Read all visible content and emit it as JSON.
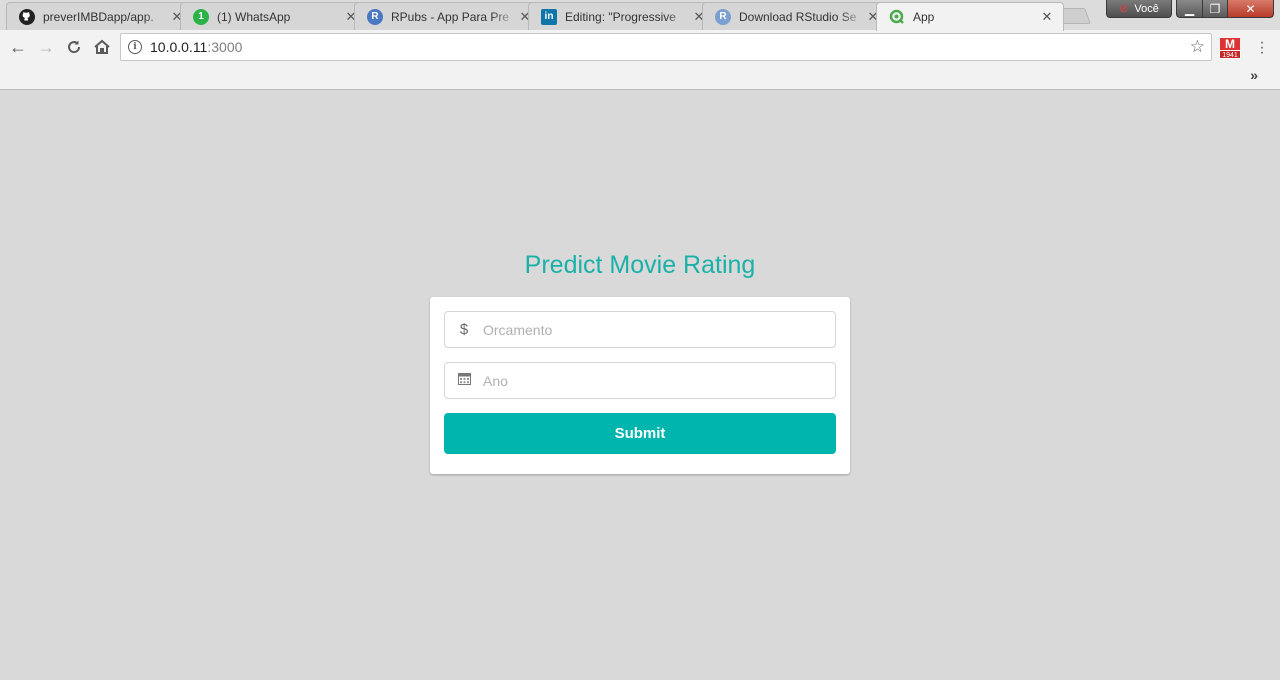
{
  "browser": {
    "tabs": [
      {
        "title": "preverIMBDapp/app.",
        "favicon": "github-icon",
        "active": false
      },
      {
        "title": "(1) WhatsApp",
        "favicon": "whatsapp-icon",
        "favicon_text": "1",
        "active": false
      },
      {
        "title": "RPubs - App Para Pre",
        "favicon": "r-icon",
        "favicon_text": "R",
        "active": false
      },
      {
        "title": "Editing: \"Progressive",
        "favicon": "linkedin-icon",
        "favicon_text": "in",
        "active": false
      },
      {
        "title": "Download RStudio Se",
        "favicon": "r-icon",
        "favicon_text": "R",
        "active": false
      },
      {
        "title": "App",
        "favicon": "qlik-icon",
        "active": true
      }
    ],
    "profile_name": "Você",
    "address": {
      "host": "10.0.0.11",
      "port": ":3000"
    },
    "extension_badge": "1941",
    "extension_letter": "M",
    "bookmarks_overflow": "»"
  },
  "page": {
    "title": "Predict Movie Rating",
    "form": {
      "budget": {
        "placeholder": "Orcamento",
        "icon": "dollar-icon",
        "icon_glyph": "$",
        "value": ""
      },
      "year": {
        "placeholder": "Ano",
        "icon": "calendar-icon",
        "value": ""
      },
      "submit_label": "Submit"
    }
  },
  "colors": {
    "accent": "#00b5ad",
    "title": "#1ab2a8",
    "background": "#d9d9d9"
  }
}
